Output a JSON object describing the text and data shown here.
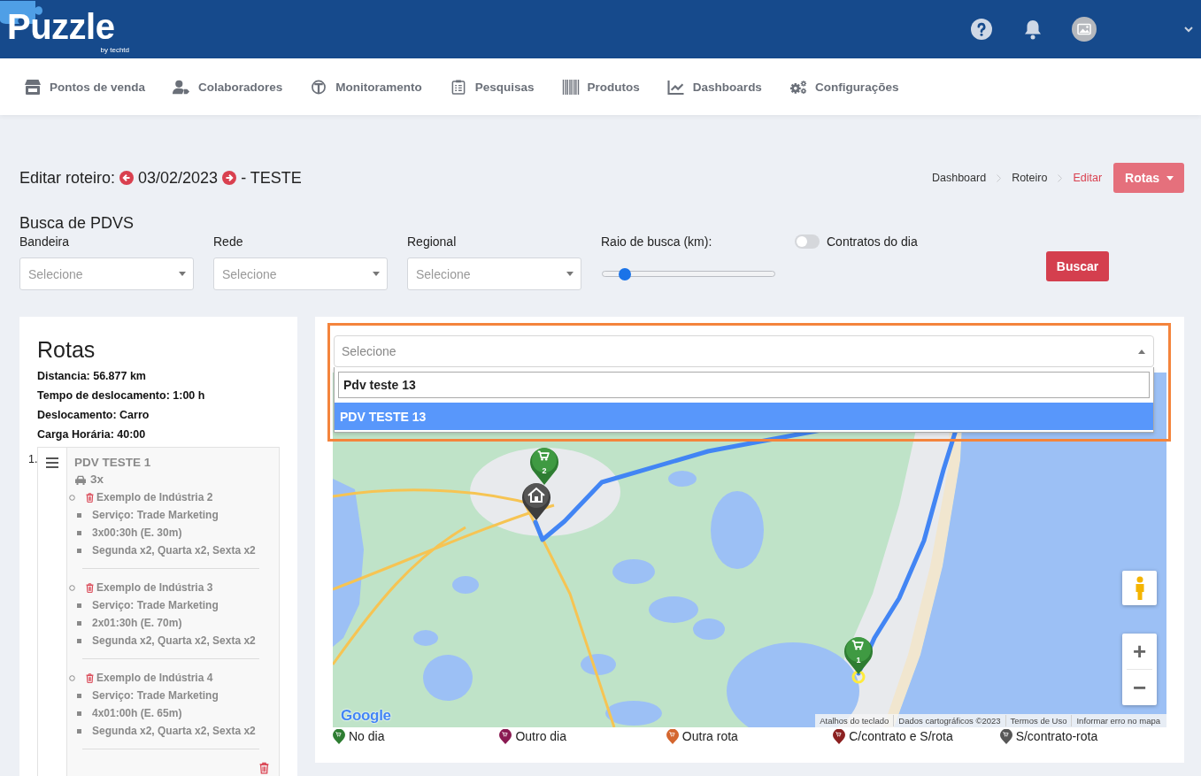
{
  "header": {
    "logo": "Puzzle",
    "tagline": "by techtd"
  },
  "nav": [
    {
      "label": "Pontos de venda"
    },
    {
      "label": "Colaboradores"
    },
    {
      "label": "Monitoramento"
    },
    {
      "label": "Pesquisas"
    },
    {
      "label": "Produtos"
    },
    {
      "label": "Dashboards"
    },
    {
      "label": "Configurações"
    }
  ],
  "page": {
    "title": "Editar roteiro:",
    "date": "03/02/2023",
    "suffix": "- TESTE",
    "breadcrumb": [
      {
        "label": "Dashboard",
        "selected": false
      },
      {
        "label": "Roteiro",
        "selected": false
      },
      {
        "label": "Editar",
        "selected": true
      }
    ],
    "menu_button": "Rotas"
  },
  "search": {
    "title": "Busca de PDVS",
    "filters": [
      {
        "label": "Bandeira",
        "placeholder": "Selecione"
      },
      {
        "label": "Rede",
        "placeholder": "Selecione"
      },
      {
        "label": "Regional",
        "placeholder": "Selecione"
      }
    ],
    "radius": {
      "label": "Raio de busca (km):",
      "level": 0.1
    },
    "contracts_toggle": {
      "label": "Contratos do dia",
      "on": false
    },
    "button": "Buscar"
  },
  "routes": {
    "title": "Rotas",
    "summary": [
      "Distancia: 56.877 km",
      "Tempo de deslocamento: 1:00 h",
      "Deslocamento: Carro",
      "Carga Horária: 40:00"
    ],
    "stops": [
      {
        "number": "1.",
        "name": "PDV TESTE 1",
        "visits": "3x",
        "industries": [
          {
            "name": "Exemplo de Indústria 2",
            "details": [
              "Serviço: Trade Marketing",
              "3x00:30h (E. 30m)",
              "Segunda x2, Quarta x2, Sexta x2"
            ]
          },
          {
            "name": "Exemplo de Indústria 3",
            "details": [
              "Serviço: Trade Marketing",
              "2x01:30h (E. 70m)",
              "Segunda x2, Quarta x2, Sexta x2"
            ]
          },
          {
            "name": "Exemplo de Indústria 4",
            "details": [
              "Serviço: Trade Marketing",
              "4x01:00h (E. 65m)",
              "Segunda x2, Quarta x2, Sexta x2"
            ]
          }
        ]
      }
    ]
  },
  "map_panel": {
    "select": {
      "placeholder": "Selecione",
      "expanded": true,
      "search_value": "Pdv teste 13",
      "options": [
        {
          "label": "PDV TESTE 13",
          "selected": true
        }
      ]
    },
    "markers": [
      {
        "kind": "cart",
        "label": "2"
      },
      {
        "kind": "home"
      },
      {
        "kind": "cart",
        "label": "1"
      }
    ],
    "zoom": {
      "in": "+",
      "out": "−"
    },
    "logo": "Google",
    "attribution": [
      "Atalhos do teclado",
      "Dados cartográficos ©2023",
      "Termos de Uso",
      "Informar erro no mapa"
    ],
    "legend": [
      {
        "label": "No dia",
        "color": "#2e7d32"
      },
      {
        "label": "Outro dia",
        "color": "#8a1a52"
      },
      {
        "label": "Outra rota",
        "color": "#d4662f"
      },
      {
        "label": "C/contrato e S/rota",
        "color": "#8b2020"
      },
      {
        "label": "S/contrato-rota",
        "color": "#575757"
      }
    ]
  }
}
